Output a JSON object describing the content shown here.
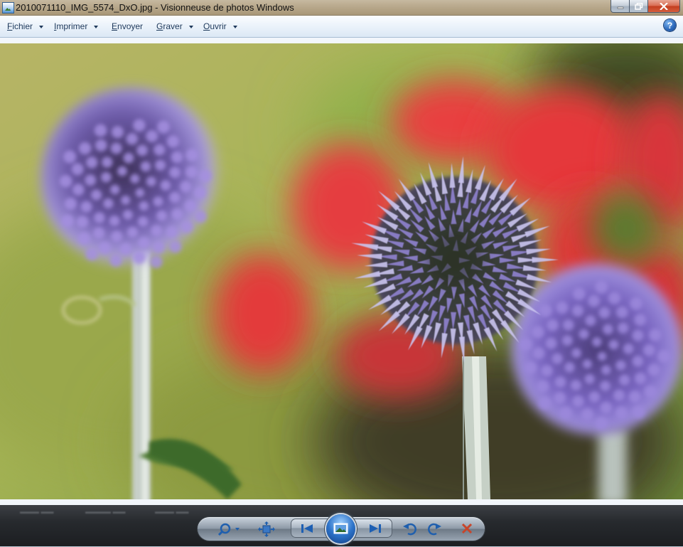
{
  "window": {
    "title": "2010071110_IMG_5574_DxO.jpg - Visionneuse de photos Windows"
  },
  "menu": {
    "items": [
      {
        "label": "Fichier",
        "has_dropdown": true
      },
      {
        "label": "Imprimer",
        "has_dropdown": true
      },
      {
        "label": "Envoyer",
        "has_dropdown": false
      },
      {
        "label": "Graver",
        "has_dropdown": true
      },
      {
        "label": "Ouvrir",
        "has_dropdown": true
      }
    ],
    "help_label": "?"
  },
  "controls": {
    "icons": [
      "zoom-icon",
      "fit-window-icon",
      "previous-icon",
      "slideshow-icon",
      "next-icon",
      "rotate-left-icon",
      "rotate-right-icon",
      "delete-icon"
    ]
  },
  "colors": {
    "close_button": "#c8452a",
    "menu_text": "#1e395b",
    "accent": "#2d73c9"
  }
}
